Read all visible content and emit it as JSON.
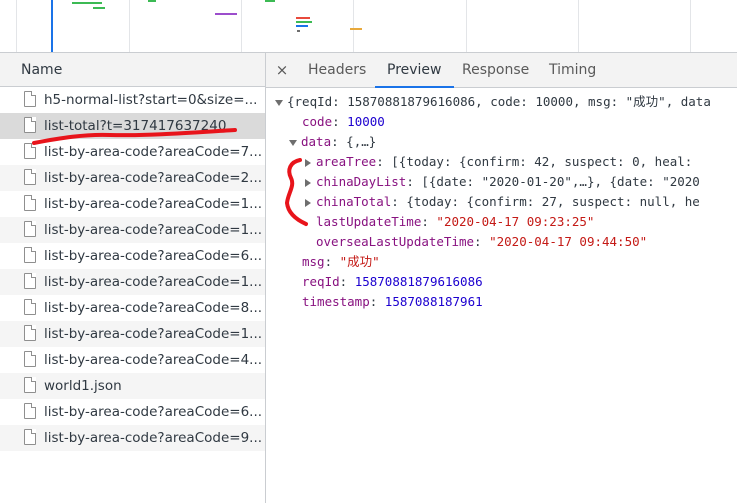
{
  "list": {
    "header": "Name",
    "items": [
      {
        "label": "h5-normal-list?start=0&size=..."
      },
      {
        "label": "list-total?t=317417637240"
      },
      {
        "label": "list-by-area-code?areaCode=7..."
      },
      {
        "label": "list-by-area-code?areaCode=2..."
      },
      {
        "label": "list-by-area-code?areaCode=1..."
      },
      {
        "label": "list-by-area-code?areaCode=1..."
      },
      {
        "label": "list-by-area-code?areaCode=6..."
      },
      {
        "label": "list-by-area-code?areaCode=1..."
      },
      {
        "label": "list-by-area-code?areaCode=8..."
      },
      {
        "label": "list-by-area-code?areaCode=1..."
      },
      {
        "label": "list-by-area-code?areaCode=4..."
      },
      {
        "label": "world1.json"
      },
      {
        "label": "list-by-area-code?areaCode=6..."
      },
      {
        "label": "list-by-area-code?areaCode=9..."
      }
    ],
    "selected_index": 1
  },
  "tabs": {
    "close": "×",
    "items": [
      "Headers",
      "Preview",
      "Response",
      "Timing"
    ],
    "active": "Preview"
  },
  "preview": {
    "root_summary": "{reqId: 15870881879616086, code: 10000, msg: \"成功\", data",
    "code_key": "code",
    "code_val": "10000",
    "data_key": "data",
    "data_val": "{,…}",
    "areaTree_key": "areaTree",
    "areaTree_val": "[{today: {confirm: 42, suspect: 0, heal:",
    "chinaDayList_key": "chinaDayList",
    "chinaDayList_val": "[{date: \"2020-01-20\",…}, {date: \"2020",
    "chinaTotal_key": "chinaTotal",
    "chinaTotal_val": "{today: {confirm: 27, suspect: null, he",
    "lastUpdateTime_key": "lastUpdateTime",
    "lastUpdateTime_val": "\"2020-04-17 09:23:25\"",
    "overseaLastUpdateTime_key": "overseaLastUpdateTime",
    "overseaLastUpdateTime_val": "\"2020-04-17 09:44:50\"",
    "msg_key": "msg",
    "msg_val": "\"成功\"",
    "reqId_key": "reqId",
    "reqId_val": "15870881879616086",
    "timestamp_key": "timestamp",
    "timestamp_val": "1587088187961"
  },
  "colors": {
    "accent": "#1a73e8",
    "annotation": "#e8141b",
    "string": "#c41a16",
    "number": "#1c00cf",
    "key": "#881280"
  }
}
